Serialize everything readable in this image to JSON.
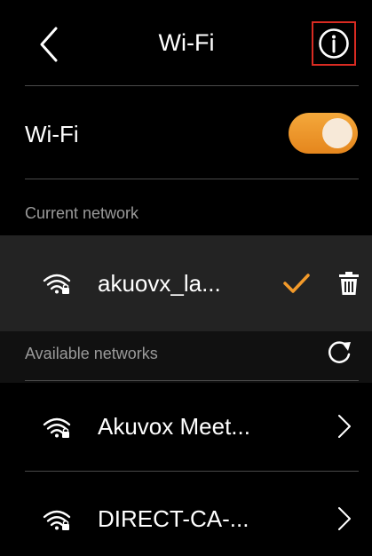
{
  "header": {
    "title": "Wi-Fi",
    "back_icon": "chevron-left-icon",
    "info_icon": "info-circle-icon"
  },
  "wifi": {
    "label": "Wi-Fi",
    "enabled": true,
    "toggle_color": "#EE9428"
  },
  "current": {
    "section_label": "Current network",
    "network": {
      "name": "akuovx_la...",
      "icon": "wifi-lock-icon",
      "connected_icon": "checkmark-icon",
      "delete_icon": "trash-icon"
    }
  },
  "available": {
    "section_label": "Available networks",
    "refresh_icon": "refresh-icon",
    "networks": [
      {
        "name": "Akuvox Meet...",
        "icon": "wifi-lock-icon",
        "action_icon": "chevron-right-icon"
      },
      {
        "name": "DIRECT-CA-...",
        "icon": "wifi-lock-icon",
        "action_icon": "chevron-right-icon"
      }
    ]
  },
  "colors": {
    "accent": "#F39A2A",
    "highlight_box": "#D92B22",
    "background": "#000000",
    "current_row_bg": "#232323"
  }
}
